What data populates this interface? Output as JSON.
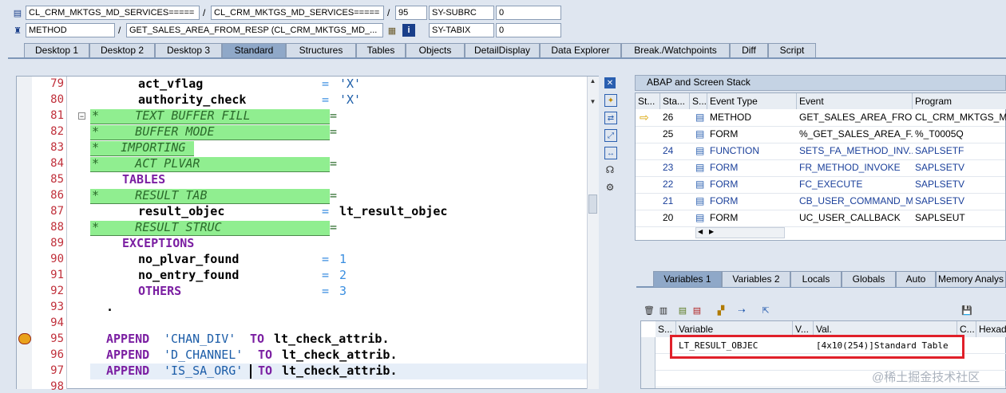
{
  "header": {
    "row1": {
      "program": "CL_CRM_MKTGS_MD_SERVICES=====",
      "include": "CL_CRM_MKTGS_MD_SERVICES=====",
      "line": "95",
      "sysvar": "SY-SUBRC",
      "sysval": "0"
    },
    "row2": {
      "type": "METHOD",
      "event": "GET_SALES_AREA_FROM_RESP (CL_CRM_MKTGS_MD_...",
      "sysvar": "SY-TABIX",
      "sysval": "0"
    },
    "slash": "/"
  },
  "tabs": [
    "Desktop 1",
    "Desktop 2",
    "Desktop 3",
    "Standard",
    "Structures",
    "Tables",
    "Objects",
    "DetailDisplay",
    "Data Explorer",
    "Break./Watchpoints",
    "Diff",
    "Script"
  ],
  "code": {
    "lines": [
      {
        "n": "79"
      },
      {
        "n": "80"
      },
      {
        "n": "81"
      },
      {
        "n": "82"
      },
      {
        "n": "83"
      },
      {
        "n": "84"
      },
      {
        "n": "85"
      },
      {
        "n": "86"
      },
      {
        "n": "87"
      },
      {
        "n": "88"
      },
      {
        "n": "89"
      },
      {
        "n": "90"
      },
      {
        "n": "91"
      },
      {
        "n": "92"
      },
      {
        "n": "93"
      },
      {
        "n": "94"
      },
      {
        "n": "95"
      },
      {
        "n": "96"
      },
      {
        "n": "97"
      },
      {
        "n": "98"
      }
    ],
    "l79a": "act_vflag",
    "eq": "=",
    "l79b": "'X'",
    "l80a": "authority_check",
    "l80b": "'X'",
    "l81": "*     TEXT BUFFER FILL           =",
    "l82": "*     BUFFER MODE                =",
    "l83": "*   IMPORTING",
    "l84": "*     ACT PLVAR                  =",
    "l85": "TABLES",
    "l86": "*     RESULT TAB                 =",
    "l87a": "result_objec",
    "l87b": "lt_result_objec",
    "l88": "*     RESULT STRUC               =",
    "l89": "EXCEPTIONS",
    "l90a": "no_plvar_found",
    "l90b": "1",
    "l91a": "no_entry_found",
    "l91b": "2",
    "l92a": "OTHERS",
    "l92b": "3",
    "l93": ".",
    "append": "APPEND",
    "to": "TO",
    "l95s": "'CHAN_DIV'",
    "l96s": "'D_CHANNEL'",
    "l97s": "'IS_SA_ORG'",
    "target": "lt_check_attrib."
  },
  "stack": {
    "title": "ABAP and Screen Stack",
    "columns": [
      "St...",
      "Sta...",
      "S...",
      "Event Type",
      "Event",
      "Program"
    ],
    "rows": [
      {
        "level": "26",
        "type": "METHOD",
        "event": "GET_SALES_AREA_FRO...",
        "program": "CL_CRM_MKTGS_MD_"
      },
      {
        "level": "25",
        "type": "FORM",
        "event": "%_GET_SALES_AREA_F...",
        "program": "%_T0005Q"
      },
      {
        "level": "24",
        "type": "FUNCTION",
        "event": "SETS_FA_METHOD_INV...",
        "program": "SAPLSETF"
      },
      {
        "level": "23",
        "type": "FORM",
        "event": "FR_METHOD_INVOKE",
        "program": "SAPLSETV"
      },
      {
        "level": "22",
        "type": "FORM",
        "event": "FC_EXECUTE",
        "program": "SAPLSETV"
      },
      {
        "level": "21",
        "type": "FORM",
        "event": "CB_USER_COMMAND_ME...",
        "program": "SAPLSETV"
      },
      {
        "level": "20",
        "type": "FORM",
        "event": "UC_USER_CALLBACK",
        "program": "SAPLSEUT"
      }
    ]
  },
  "vartabs": [
    "Variables 1",
    "Variables 2",
    "Locals",
    "Globals",
    "Auto",
    "Memory Analys"
  ],
  "vars": {
    "columns": [
      "S...",
      "Variable",
      "V...",
      "Val.",
      "C...",
      "Hexade"
    ],
    "rows": [
      {
        "name": "LT_RESULT_OBJEC",
        "value": "[4x10(254)]Standard Table"
      }
    ],
    "highlight_color": "#e0202a"
  },
  "watermark": "@稀土掘金技术社区"
}
